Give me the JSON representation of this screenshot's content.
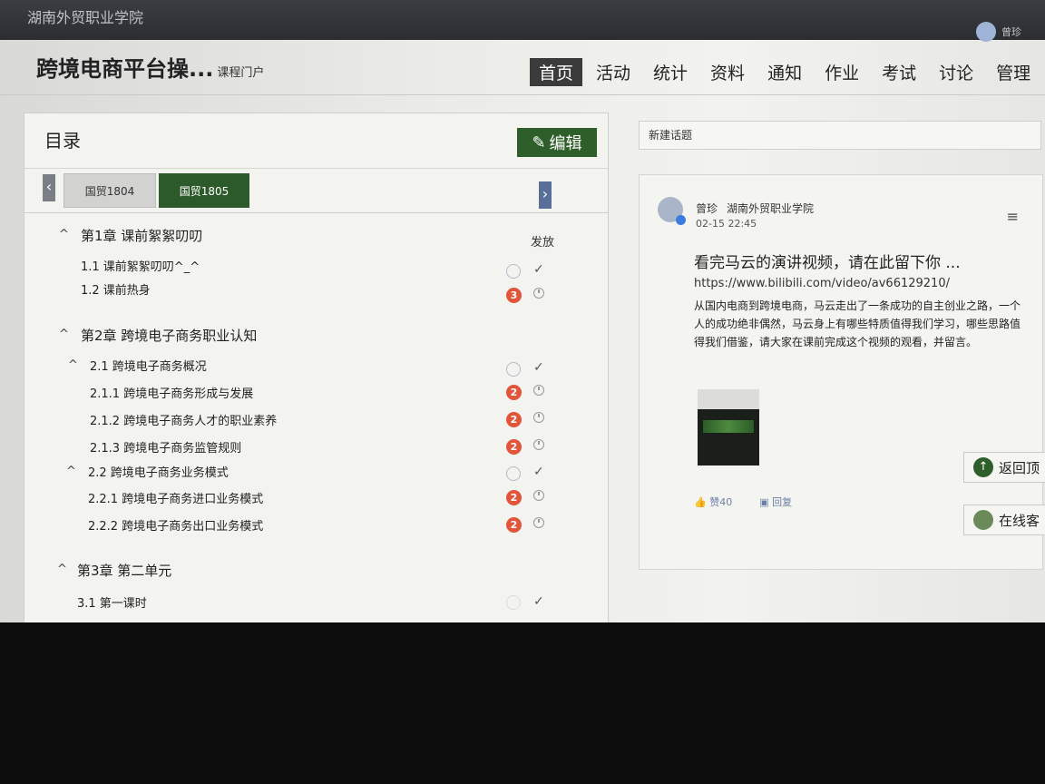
{
  "topbar": {
    "school": "湖南外贸职业学院",
    "user": "曾珍"
  },
  "header": {
    "course_title": "跨境电商平台操...",
    "portal": "课程门户"
  },
  "nav": [
    "首页",
    "活动",
    "统计",
    "资料",
    "通知",
    "作业",
    "考试",
    "讨论",
    "管理"
  ],
  "catalog": {
    "title": "目录",
    "edit_label": "编辑",
    "class_tabs": [
      "国贸1804",
      "国贸1805"
    ],
    "column_header": "发放",
    "rows": [
      {
        "text": "第1章 课前絮絮叨叨"
      },
      {
        "text": "1.1  课前絮絮叨叨^_^"
      },
      {
        "text": "1.2  课前热身",
        "badge": "3"
      },
      {
        "text": "第2章 跨境电子商务职业认知"
      },
      {
        "text": "2.1  跨境电子商务概况"
      },
      {
        "text": "2.1.1 跨境电子商务形成与发展",
        "badge": "2"
      },
      {
        "text": "2.1.2 跨境电子商务人才的职业素养",
        "badge": "2"
      },
      {
        "text": "2.1.3 跨境电子商务监管规则",
        "badge": "2"
      },
      {
        "text": "2.2  跨境电子商务业务模式"
      },
      {
        "text": "2.2.1 跨境电子商务进口业务模式",
        "badge": "2"
      },
      {
        "text": "2.2.2 跨境电子商务出口业务模式",
        "badge": "2"
      },
      {
        "text": "第3章 第二单元"
      },
      {
        "text": "3.1  第一课时"
      }
    ]
  },
  "discussion": {
    "new_topic_placeholder": "新建话题",
    "post": {
      "author": "曾珍",
      "school": "湖南外贸职业学院",
      "time": "02-15 22:45",
      "title": "看完马云的演讲视频，请在此留下你 ...",
      "link": "https://www.bilibili.com/video/av66129210/",
      "body": "从国内电商到跨境电商，马云走出了一条成功的自主创业之路，一个人的成功绝非偶然，马云身上有哪些特质值得我们学习，哪些思路值得我们借鉴，请大家在课前完成这个视频的观看，并留言。",
      "likes": "赞40",
      "reply": "回复"
    }
  },
  "floating": {
    "back_top": "返回顶",
    "online_service": "在线客"
  },
  "colors": {
    "accent_green": "#2e5e2a",
    "badge_red": "#e2553b",
    "topbar": "#2b2d31"
  }
}
